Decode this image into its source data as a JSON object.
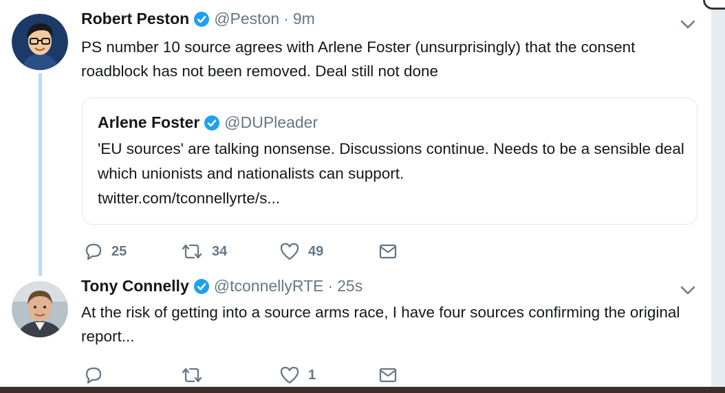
{
  "tweets": [
    {
      "name": "Robert Peston",
      "handle": "@Peston",
      "separator": "·",
      "time": "9m",
      "text": "PS number 10 source agrees with Arlene Foster (unsurprisingly) that the consent roadblock has not been removed. Deal still not done",
      "avatar_icon": "cartoon-man-with-glasses",
      "quote": {
        "name": "Arlene Foster",
        "handle": "@DUPleader",
        "text": "'EU sources' are talking nonsense. Discussions continue.  Needs to be a sensible deal which unionists and nationalists can support.",
        "link": "twitter.com/tconnellyrte/s..."
      },
      "actions": {
        "replies": "25",
        "retweets": "34",
        "likes": "49"
      }
    },
    {
      "name": "Tony Connelly",
      "handle": "@tconnellyRTE",
      "separator": "·",
      "time": "25s",
      "text": "At the risk of getting into a source arms race, I have four sources confirming the original report...",
      "avatar_icon": "photo-man-portrait",
      "actions": {
        "replies": "",
        "retweets": "",
        "likes": "1"
      }
    }
  ],
  "colors": {
    "verified": "#1da1f2",
    "secondary_text": "#657786",
    "thread_line": "#b8dcf7",
    "primary_text": "#14171a"
  }
}
